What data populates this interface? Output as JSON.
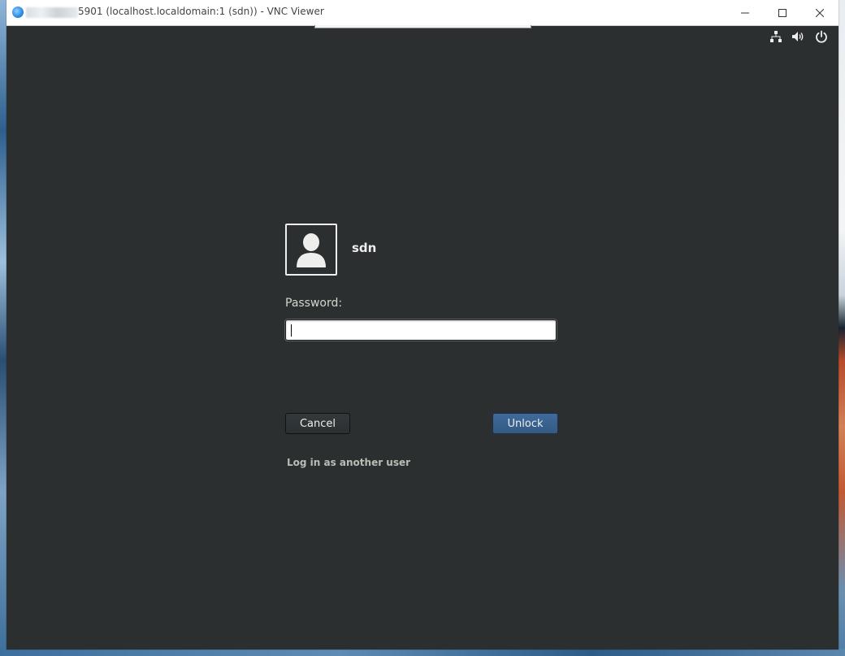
{
  "window": {
    "title": "5901 (localhost.localdomain:1 (sdn)) - VNC Viewer",
    "app_icon": "vnc-viewer-icon",
    "controls": {
      "minimize": "minimize-icon",
      "maximize": "maximize-icon",
      "close": "close-icon"
    }
  },
  "system_tray": {
    "icons": [
      "network-wired-icon",
      "volume-icon",
      "power-icon"
    ]
  },
  "unlock_dialog": {
    "avatar_icon": "user-avatar-icon",
    "username": "sdn",
    "password_label": "Password:",
    "password_value": "",
    "cancel_label": "Cancel",
    "unlock_label": "Unlock",
    "switch_user_label": "Log in as another user"
  },
  "colors": {
    "background": "#2b2f30",
    "unlock_button": "#3b6390",
    "text": "#eeeeec"
  }
}
